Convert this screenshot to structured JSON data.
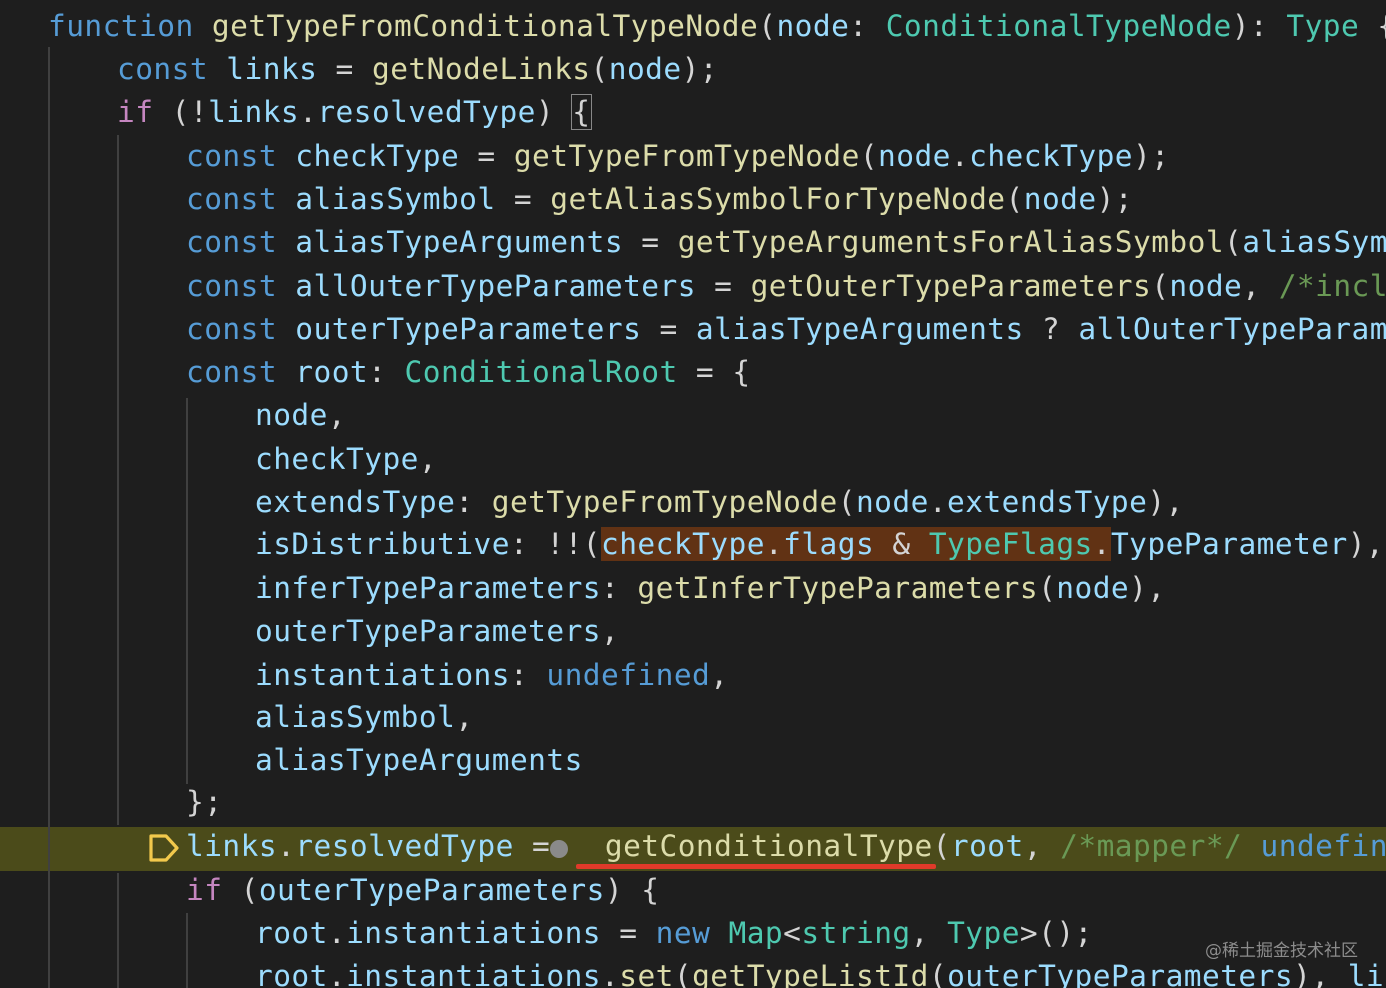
{
  "colors": {
    "background": "#1e1e1e",
    "current_line_highlight": "#4b4b1a",
    "selection_highlight": "#613214",
    "error_underline": "#e03a2a",
    "breakpoint": "#f2c94c"
  },
  "icons": {
    "breakpoint": "debug-stackframe-icon",
    "inline_breakpoint": "inline-breakpoint-dot-icon"
  },
  "code": {
    "lines": [
      [
        [
          "kw",
          "function"
        ],
        [
          "txt",
          " "
        ],
        [
          "fn",
          "getTypeFromConditionalTypeNode"
        ],
        [
          "txt",
          "("
        ],
        [
          "var",
          "node"
        ],
        [
          "txt",
          ": "
        ],
        [
          "type",
          "ConditionalTypeNode"
        ],
        [
          "txt",
          "): "
        ],
        [
          "type",
          "Type"
        ],
        [
          "txt",
          " {"
        ]
      ],
      [
        [
          "kw",
          "const"
        ],
        [
          "txt",
          " "
        ],
        [
          "var",
          "links"
        ],
        [
          "txt",
          " = "
        ],
        [
          "fn",
          "getNodeLinks"
        ],
        [
          "txt",
          "("
        ],
        [
          "var",
          "node"
        ],
        [
          "txt",
          ");"
        ]
      ],
      [
        [
          "ctl",
          "if"
        ],
        [
          "txt",
          " (!"
        ],
        [
          "var",
          "links"
        ],
        [
          "txt",
          "."
        ],
        [
          "var",
          "resolvedType"
        ],
        [
          "txt",
          ") "
        ],
        [
          "bracket",
          "{"
        ]
      ],
      [
        [
          "kw",
          "const"
        ],
        [
          "txt",
          " "
        ],
        [
          "var",
          "checkType"
        ],
        [
          "txt",
          " = "
        ],
        [
          "fn",
          "getTypeFromTypeNode"
        ],
        [
          "txt",
          "("
        ],
        [
          "var",
          "node"
        ],
        [
          "txt",
          "."
        ],
        [
          "var",
          "checkType"
        ],
        [
          "txt",
          ");"
        ]
      ],
      [
        [
          "kw",
          "const"
        ],
        [
          "txt",
          " "
        ],
        [
          "var",
          "aliasSymbol"
        ],
        [
          "txt",
          " = "
        ],
        [
          "fn",
          "getAliasSymbolForTypeNode"
        ],
        [
          "txt",
          "("
        ],
        [
          "var",
          "node"
        ],
        [
          "txt",
          ");"
        ]
      ],
      [
        [
          "kw",
          "const"
        ],
        [
          "txt",
          " "
        ],
        [
          "var",
          "aliasTypeArguments"
        ],
        [
          "txt",
          " = "
        ],
        [
          "fn",
          "getTypeArgumentsForAliasSymbol"
        ],
        [
          "txt",
          "("
        ],
        [
          "var",
          "aliasSymbol"
        ]
      ],
      [
        [
          "kw",
          "const"
        ],
        [
          "txt",
          " "
        ],
        [
          "var",
          "allOuterTypeParameters"
        ],
        [
          "txt",
          " = "
        ],
        [
          "fn",
          "getOuterTypeParameters"
        ],
        [
          "txt",
          "("
        ],
        [
          "var",
          "node"
        ],
        [
          "txt",
          ", "
        ],
        [
          "cmt",
          "/*include"
        ]
      ],
      [
        [
          "kw",
          "const"
        ],
        [
          "txt",
          " "
        ],
        [
          "var",
          "outerTypeParameters"
        ],
        [
          "txt",
          " = "
        ],
        [
          "var",
          "aliasTypeArguments"
        ],
        [
          "txt",
          " ? "
        ],
        [
          "var",
          "allOuterTypeParamete"
        ]
      ],
      [
        [
          "kw",
          "const"
        ],
        [
          "txt",
          " "
        ],
        [
          "var",
          "root"
        ],
        [
          "txt",
          ": "
        ],
        [
          "type",
          "ConditionalRoot"
        ],
        [
          "txt",
          " = {"
        ]
      ],
      [
        [
          "var",
          "node"
        ],
        [
          "txt",
          ","
        ]
      ],
      [
        [
          "var",
          "checkType"
        ],
        [
          "txt",
          ","
        ]
      ],
      [
        [
          "var",
          "extendsType"
        ],
        [
          "txt",
          ": "
        ],
        [
          "fn",
          "getTypeFromTypeNode"
        ],
        [
          "txt",
          "("
        ],
        [
          "var",
          "node"
        ],
        [
          "txt",
          "."
        ],
        [
          "var",
          "extendsType"
        ],
        [
          "txt",
          "),"
        ]
      ],
      [
        [
          "var",
          "isDistributive"
        ],
        [
          "txt",
          ": !!("
        ],
        [
          "selvar",
          "checkType"
        ],
        [
          "seltxt",
          "."
        ],
        [
          "selvar",
          "flags"
        ],
        [
          "seltxt",
          " & "
        ],
        [
          "seltype",
          "TypeFlags"
        ],
        [
          "seltxt",
          "."
        ],
        [
          "var",
          "TypeParameter"
        ],
        [
          "txt",
          "),"
        ]
      ],
      [
        [
          "var",
          "inferTypeParameters"
        ],
        [
          "txt",
          ": "
        ],
        [
          "fn",
          "getInferTypeParameters"
        ],
        [
          "txt",
          "("
        ],
        [
          "var",
          "node"
        ],
        [
          "txt",
          "),"
        ]
      ],
      [
        [
          "var",
          "outerTypeParameters"
        ],
        [
          "txt",
          ","
        ]
      ],
      [
        [
          "var",
          "instantiations"
        ],
        [
          "txt",
          ": "
        ],
        [
          "kw",
          "undefined"
        ],
        [
          "txt",
          ","
        ]
      ],
      [
        [
          "var",
          "aliasSymbol"
        ],
        [
          "txt",
          ","
        ]
      ],
      [
        [
          "var",
          "aliasTypeArguments"
        ]
      ],
      [
        [
          "txt",
          "};"
        ]
      ],
      [
        [
          "var",
          "links"
        ],
        [
          "txt",
          "."
        ],
        [
          "var",
          "resolvedType"
        ],
        [
          "txt",
          " = "
        ],
        [
          "txt",
          "  "
        ],
        [
          "fn",
          "getConditionalType"
        ],
        [
          "txt",
          "("
        ],
        [
          "var",
          "root"
        ],
        [
          "txt",
          ", "
        ],
        [
          "cmt",
          "/*mapper*/"
        ],
        [
          "txt",
          " "
        ],
        [
          "kw",
          "undefined"
        ],
        [
          "txt",
          ");"
        ]
      ],
      [
        [
          "ctl",
          "if"
        ],
        [
          "txt",
          " ("
        ],
        [
          "var",
          "outerTypeParameters"
        ],
        [
          "txt",
          ") {"
        ]
      ],
      [
        [
          "var",
          "root"
        ],
        [
          "txt",
          "."
        ],
        [
          "var",
          "instantiations"
        ],
        [
          "txt",
          " = "
        ],
        [
          "kw",
          "new"
        ],
        [
          "txt",
          " "
        ],
        [
          "type",
          "Map"
        ],
        [
          "txt",
          "<"
        ],
        [
          "type",
          "string"
        ],
        [
          "txt",
          ", "
        ],
        [
          "type",
          "Type"
        ],
        [
          "txt",
          ">();"
        ]
      ],
      [
        [
          "var",
          "root"
        ],
        [
          "txt",
          "."
        ],
        [
          "var",
          "instantiations"
        ],
        [
          "txt",
          "."
        ],
        [
          "fn",
          "set"
        ],
        [
          "txt",
          "("
        ],
        [
          "fn",
          "getTypeListId"
        ],
        [
          "txt",
          "("
        ],
        [
          "var",
          "outerTypeParameters"
        ],
        [
          "txt",
          "), "
        ],
        [
          "var",
          "links"
        ]
      ]
    ]
  },
  "watermark": "@稀土掘金技术社区"
}
